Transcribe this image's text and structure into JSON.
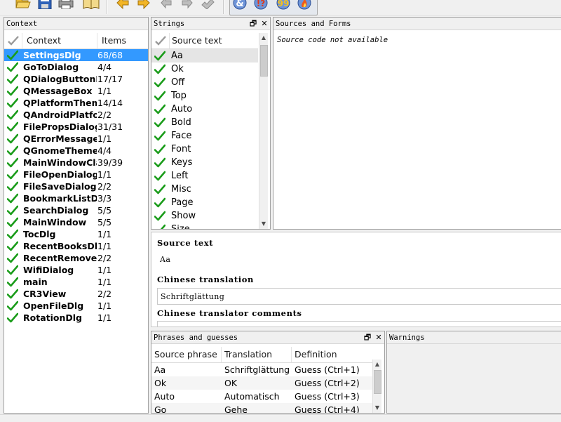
{
  "toolbar": {
    "buttons": [
      {
        "name": "open-icon",
        "glyph": "📂"
      },
      {
        "name": "save-icon",
        "glyph": "💾"
      },
      {
        "name": "print-icon",
        "glyph": "🖨"
      },
      {
        "name": "phrasebook-icon",
        "glyph": "📖"
      },
      {
        "name": "prev-icon",
        "glyph": "◀"
      },
      {
        "name": "next-icon",
        "glyph": "▶"
      },
      {
        "name": "prev-unfinished-icon",
        "glyph": "↶"
      },
      {
        "name": "next-unfinished-icon",
        "glyph": "↷"
      },
      {
        "name": "done-next-icon",
        "glyph": "↪"
      },
      {
        "name": "accelerators-icon",
        "glyph": "&"
      },
      {
        "name": "punctuation-icon",
        "glyph": "!?"
      },
      {
        "name": "phrase-match-icon",
        "glyph": "99"
      },
      {
        "name": "placeholder-icon",
        "glyph": "🔥"
      }
    ]
  },
  "context_panel": {
    "title": "Context",
    "columns": {
      "context": "Context",
      "items": "Items"
    },
    "rows": [
      {
        "name": "SettingsDlg",
        "items": "68/68",
        "selected": true
      },
      {
        "name": "GoToDialog",
        "items": "4/4"
      },
      {
        "name": "QDialogButtonBox",
        "items": "17/17"
      },
      {
        "name": "QMessageBox",
        "items": "1/1"
      },
      {
        "name": "QPlatformTheme",
        "items": "14/14"
      },
      {
        "name": "QAndroidPlatformTheme",
        "items": "2/2"
      },
      {
        "name": "FilePropsDialog",
        "items": "31/31"
      },
      {
        "name": "QErrorMessage",
        "items": "1/1"
      },
      {
        "name": "QGnomeTheme",
        "items": "4/4"
      },
      {
        "name": "MainWindowClass",
        "items": "39/39"
      },
      {
        "name": "FileOpenDialog",
        "items": "1/1"
      },
      {
        "name": "FileSaveDialog",
        "items": "2/2"
      },
      {
        "name": "BookmarkListDialog",
        "items": "3/3"
      },
      {
        "name": "SearchDialog",
        "items": "5/5"
      },
      {
        "name": "MainWindow",
        "items": "5/5"
      },
      {
        "name": "TocDlg",
        "items": "1/1"
      },
      {
        "name": "RecentBooksDlg",
        "items": "1/1"
      },
      {
        "name": "RecentRemoveDlg",
        "items": "2/2"
      },
      {
        "name": "WifiDialog",
        "items": "1/1"
      },
      {
        "name": "main",
        "items": "1/1"
      },
      {
        "name": "CR3View",
        "items": "2/2"
      },
      {
        "name": "OpenFileDlg",
        "items": "1/1"
      },
      {
        "name": "RotationDlg",
        "items": "1/1"
      }
    ]
  },
  "strings_panel": {
    "title": "Strings",
    "column": "Source text",
    "rows": [
      {
        "text": "Aa",
        "selected": true
      },
      {
        "text": "Ok"
      },
      {
        "text": "Off"
      },
      {
        "text": "Top"
      },
      {
        "text": "Auto"
      },
      {
        "text": "Bold"
      },
      {
        "text": "Face"
      },
      {
        "text": "Font"
      },
      {
        "text": "Keys"
      },
      {
        "text": "Left"
      },
      {
        "text": "Misc"
      },
      {
        "text": "Page"
      },
      {
        "text": "Show"
      },
      {
        "text": "Size"
      }
    ]
  },
  "sources_panel": {
    "title": "Sources and Forms",
    "message": "Source code not available"
  },
  "editor": {
    "source_label": "Source text",
    "source_value": "Aa",
    "translation_label": "Chinese translation",
    "translation_value": "Schriftglättung",
    "comments_label": "Chinese translator comments"
  },
  "phrases_panel": {
    "title": "Phrases and guesses",
    "columns": {
      "source": "Source phrase",
      "translation": "Translation",
      "definition": "Definition"
    },
    "rows": [
      {
        "source": "Aa",
        "translation": "Schriftglättung",
        "definition": "Guess (Ctrl+1)"
      },
      {
        "source": "Ok",
        "translation": "OK",
        "definition": "Guess (Ctrl+2)"
      },
      {
        "source": "Auto",
        "translation": "Automatisch",
        "definition": "Guess (Ctrl+3)"
      },
      {
        "source": "Go",
        "translation": "Gehe",
        "definition": "Guess (Ctrl+4)"
      }
    ]
  },
  "warnings_panel": {
    "title": "Warnings"
  },
  "dock_buttons": {
    "float": "🗗",
    "close": "✕"
  },
  "colors": {
    "selection": "#3399ff",
    "check": "#1a9c1a",
    "panel_border": "#a0a0a0"
  }
}
